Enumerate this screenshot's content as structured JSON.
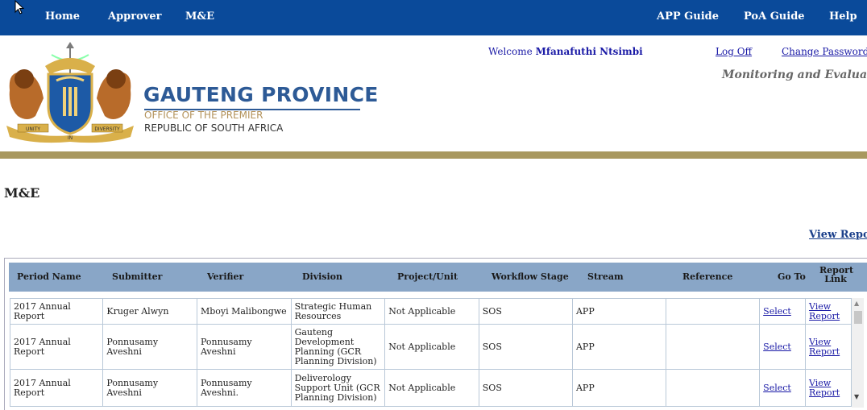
{
  "nav": {
    "left": [
      "Home",
      "Approver",
      "M&E"
    ],
    "right": [
      "APP Guide",
      "PoA Guide",
      "Help"
    ]
  },
  "brand": {
    "title": "GAUTENG PROVINCE",
    "office": "OFFICE OF THE PREMIER",
    "country": "REPUBLIC OF SOUTH AFRICA",
    "motto_left": "UNITY",
    "motto_mid": "IN",
    "motto_right": "DIVERSITY"
  },
  "user": {
    "welcome_label": "Welcome",
    "name": "Mfanafuthi Ntsimbi",
    "logoff": "Log Off",
    "change_password": "Change Password"
  },
  "header_subtitle": "Monitoring and Evaluation",
  "page_title": "M&E",
  "view_report_top": "View Repor",
  "grid": {
    "columns": [
      "Period Name",
      "Submitter",
      "Verifier",
      "Division",
      "Project/Unit",
      "Workflow Stage",
      "Stream",
      "Reference",
      "Go To",
      "Report Link"
    ],
    "rows": [
      {
        "period": "2017 Annual Report",
        "submitter": "Kruger Alwyn",
        "verifier": "Mboyi Malibongwe",
        "division": "Strategic Human Resources",
        "project": "Not Applicable",
        "stage": "SOS",
        "stream": "APP",
        "reference": "",
        "goto": "Select",
        "report": "View Report"
      },
      {
        "period": "2017 Annual Report",
        "submitter": "Ponnusamy Aveshni",
        "verifier": "Ponnusamy Aveshni",
        "division": "Gauteng Development Planning (GCR Planning Division)",
        "project": "Not Applicable",
        "stage": "SOS",
        "stream": "APP",
        "reference": "",
        "goto": "Select",
        "report": "View Report"
      },
      {
        "period": "2017 Annual Report",
        "submitter": "Ponnusamy Aveshni",
        "verifier": "Ponnusamy Aveshni.",
        "division": "Deliverology Support Unit (GCR Planning Division)",
        "project": "Not Applicable",
        "stage": "SOS",
        "stream": "APP",
        "reference": "",
        "goto": "Select",
        "report": "View Report"
      }
    ]
  },
  "colors": {
    "nav_bg": "#0a4a9a",
    "gold_band": "#a8985f",
    "grid_header": "#89a6c7",
    "brand_blue": "#2d5a96"
  }
}
